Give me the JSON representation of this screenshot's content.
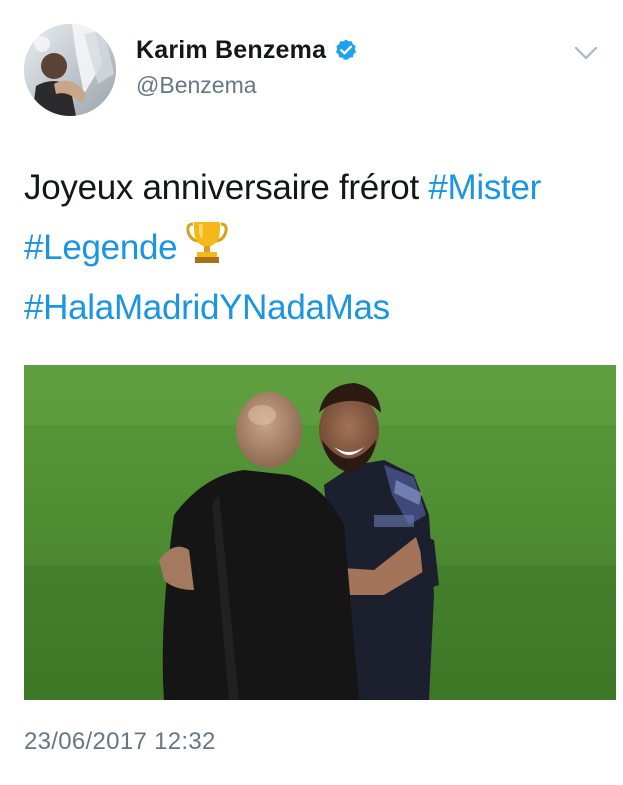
{
  "user": {
    "display_name": "Karim Benzema",
    "handle": "@Benzema",
    "verified": true,
    "avatar_icon": "profile-photo"
  },
  "menu": {
    "icon": "chevron-down-icon"
  },
  "tweet": {
    "text_parts": {
      "plain": "Joyeux anniversaire frérot",
      "hashtag_1": "#Mister",
      "hashtag_2": "#Legende",
      "emoji": "trophy-emoji",
      "hashtag_3": "#HalaMadridYNadaMas"
    },
    "timestamp": "23/06/2017 12:32"
  },
  "colors": {
    "hashtag": "#1b95e0",
    "secondary_text": "#657786",
    "primary_text": "#14171a",
    "verified_badge": "#1da1f2"
  }
}
